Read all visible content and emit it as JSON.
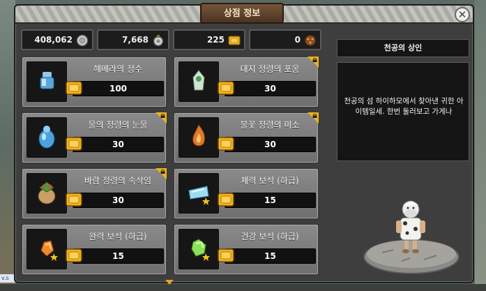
{
  "window": {
    "title": "상점 정보",
    "close_glyph": "✕"
  },
  "currencies": [
    {
      "value": "408,062",
      "icon": "silver-coin-icon"
    },
    {
      "value": "7,668",
      "icon": "medal-icon"
    },
    {
      "value": "225",
      "icon": "gold-ticket-icon"
    },
    {
      "value": "0",
      "icon": "bronze-token-icon"
    }
  ],
  "items": [
    {
      "name": "헤메라의 정수",
      "price": "100",
      "icon": "blue-essence-icon",
      "locked": false
    },
    {
      "name": "대지 정령의 포옹",
      "price": "30",
      "icon": "earth-spirit-icon",
      "locked": true
    },
    {
      "name": "물의 정령의 눈물",
      "price": "30",
      "icon": "water-spirit-icon",
      "locked": true
    },
    {
      "name": "불꽃 정령의 미소",
      "price": "30",
      "icon": "fire-spirit-icon",
      "locked": true
    },
    {
      "name": "바람 정령의 속삭임",
      "price": "30",
      "icon": "wind-spirit-icon",
      "locked": true
    },
    {
      "name": "체력 보석 (하급)",
      "price": "15",
      "icon": "stamina-gem-icon",
      "locked": false
    },
    {
      "name": "완력 보석 (하급)",
      "price": "15",
      "icon": "strength-gem-icon",
      "locked": false
    },
    {
      "name": "건강 보석 (하급)",
      "price": "15",
      "icon": "health-gem-icon",
      "locked": false
    }
  ],
  "merchant": {
    "name": "천공의 상인",
    "message": "천공의 섬 하이하모에서 찾아낸 귀한 아이템일세. 한번 둘러보고 가게나"
  },
  "background": {
    "tag": "v.s"
  },
  "colors": {
    "accent": "#f0b21a",
    "panel": "#3e3e3e",
    "item_bg": "#7d7d7d"
  }
}
